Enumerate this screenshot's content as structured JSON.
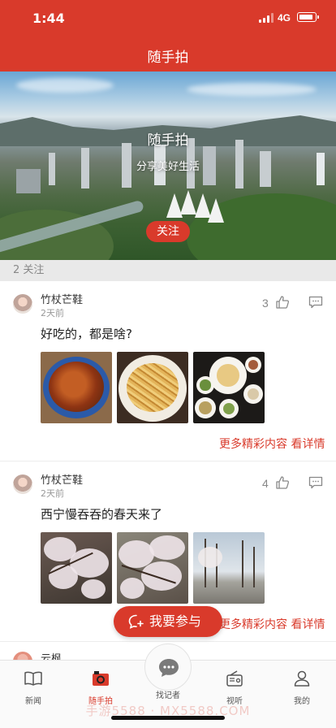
{
  "status_bar": {
    "time": "1:44",
    "network": "4G"
  },
  "header": {
    "title": "随手拍"
  },
  "banner": {
    "title": "随手拍",
    "subtitle": "分享美好生活",
    "follow_label": "关注"
  },
  "follow_count": "2 关注",
  "posts": [
    {
      "author": "竹杖芒鞋",
      "time_ago": "2天前",
      "likes": "3",
      "text": "好吃的，都是啥?",
      "more": "更多精彩内容 看详情"
    },
    {
      "author": "竹杖芒鞋",
      "time_ago": "2天前",
      "likes": "4",
      "text": "西宁慢吞吞的春天来了",
      "more": "更多精彩内容 看详情"
    },
    {
      "author": "云枫"
    }
  ],
  "join_button": {
    "label": "我要参与"
  },
  "tabs": [
    {
      "label": "新闻",
      "icon": "book-icon"
    },
    {
      "label": "随手拍",
      "icon": "camera-icon",
      "active": true
    },
    {
      "label": "找记者",
      "icon": "chat-bubble-icon"
    },
    {
      "label": "视听",
      "icon": "radio-icon"
    },
    {
      "label": "我的",
      "icon": "person-icon"
    }
  ],
  "watermark": "手游5588 · MX5588.COM",
  "colors": {
    "accent": "#d93a2b"
  }
}
